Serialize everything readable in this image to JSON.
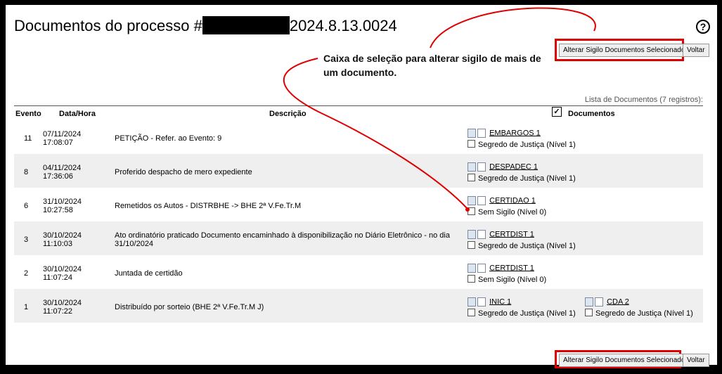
{
  "header": {
    "title_prefix": "Documentos do processo #",
    "title_suffix": "2024.8.13.0024",
    "help_glyph": "?"
  },
  "toolbar": {
    "alter_label": "Alterar Sigilo Documentos Selecionados",
    "back_label": "Voltar"
  },
  "annotation": {
    "text": "Caixa de seleção para alterar sigilo de mais de um documento.",
    "color": "#e00000"
  },
  "list": {
    "caption": "Lista de Documentos (7 registros):",
    "columns": [
      "Evento",
      "Data/Hora",
      "Descrição",
      "Documentos"
    ],
    "select_all_checked": true
  },
  "rows": [
    {
      "evento": "11",
      "date": "07/11/2024",
      "time": "17:08:07",
      "desc": "PETIÇÃO - Refer. ao Evento: 9",
      "docs": [
        {
          "name": "EMBARGOS 1",
          "sigilo": "Segredo de Justiça (Nível 1)"
        }
      ]
    },
    {
      "evento": "8",
      "date": "04/11/2024",
      "time": "17:36:06",
      "desc": "Proferido despacho de mero expediente",
      "docs": [
        {
          "name": "DESPADEC 1",
          "sigilo": "Segredo de Justiça (Nível 1)"
        }
      ]
    },
    {
      "evento": "6",
      "date": "31/10/2024",
      "time": "10:27:58",
      "desc": "Remetidos os Autos - DISTRBHE -> BHE 2ª V.Fe.Tr.M",
      "docs": [
        {
          "name": "CERTIDAO 1",
          "sigilo": "Sem Sigilo (Nível 0)"
        }
      ]
    },
    {
      "evento": "3",
      "date": "30/10/2024",
      "time": "11:10:03",
      "desc": "Ato ordinatório praticado Documento encaminhado à disponibilização no Diário Eletrônico - no dia 31/10/2024",
      "docs": [
        {
          "name": "CERTDIST 1",
          "sigilo": "Segredo de Justiça (Nível 1)"
        }
      ]
    },
    {
      "evento": "2",
      "date": "30/10/2024",
      "time": "11:07:24",
      "desc": "Juntada de certidão",
      "docs": [
        {
          "name": "CERTDIST 1",
          "sigilo": "Sem Sigilo (Nível 0)"
        }
      ]
    },
    {
      "evento": "1",
      "date": "30/10/2024",
      "time": "11:07:22",
      "desc": "Distribuído por sorteio (BHE 2ª V.Fe.Tr.M J)",
      "docs": [
        {
          "name": "INIC 1",
          "sigilo": "Segredo de Justiça (Nível 1)"
        },
        {
          "name": "CDA 2",
          "sigilo": "Segredo de Justiça (Nível 1)"
        }
      ]
    }
  ]
}
